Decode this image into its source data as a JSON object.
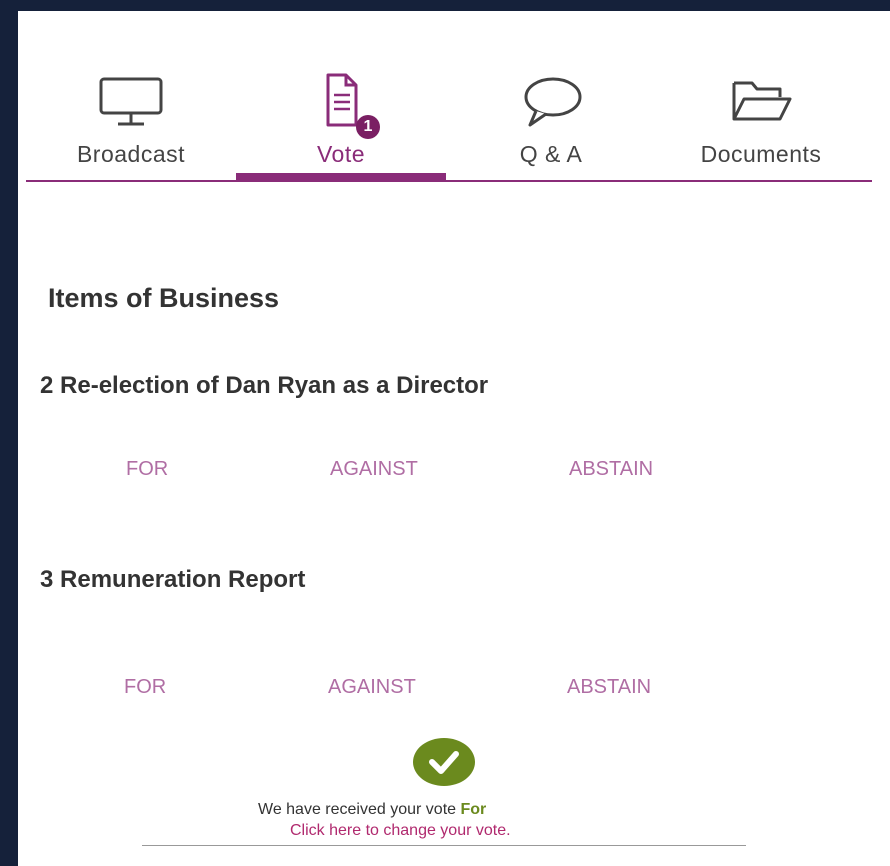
{
  "tabs": [
    {
      "label": "Broadcast",
      "icon": "monitor-icon"
    },
    {
      "label": "Vote",
      "icon": "document-icon",
      "badge": "1",
      "active": true
    },
    {
      "label": "Q & A",
      "icon": "speech-bubble-icon"
    },
    {
      "label": "Documents",
      "icon": "folder-open-icon"
    }
  ],
  "main": {
    "section_title": "Items of Business",
    "items": [
      {
        "title": "2 Re-election of Dan Ryan as a Director",
        "options": [
          "FOR",
          "AGAINST",
          "ABSTAIN"
        ]
      },
      {
        "title": "3 Remuneration Report",
        "options": [
          "FOR",
          "AGAINST",
          "ABSTAIN"
        ]
      }
    ],
    "confirmation": {
      "icon": "checkmark-circle-icon",
      "text": "We have received your vote",
      "vote": "For",
      "change_link": "Click here to change your vote."
    }
  },
  "colors": {
    "accent": "#8a2c79",
    "option_text": "#b06ea4",
    "confirm_green": "#6b8a1e",
    "link": "#b0296e",
    "background_frame": "#15213a"
  }
}
